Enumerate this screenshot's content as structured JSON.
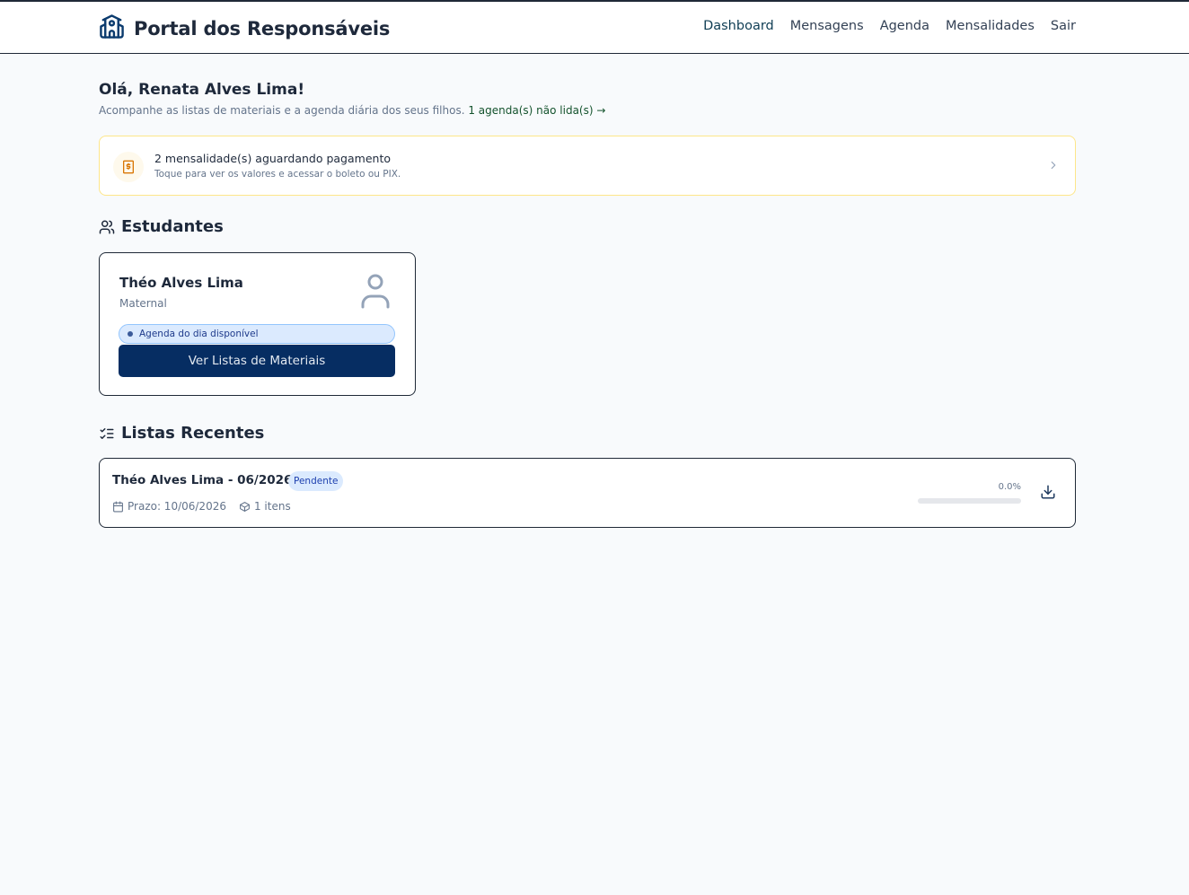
{
  "header": {
    "title": "Portal dos Responsáveis",
    "logo_icon": "school-icon",
    "nav": [
      {
        "label": "Dashboard",
        "active": true
      },
      {
        "label": "Mensagens"
      },
      {
        "label": "Agenda"
      },
      {
        "label": "Mensalidades"
      },
      {
        "label": "Sair"
      }
    ]
  },
  "greeting": {
    "title": "Olá, Renata Alves Lima!",
    "subtitle": "Acompanhe as listas de materiais e a agenda diária dos seus filhos.",
    "agenda_link": "1 agenda(s) não lida(s) →"
  },
  "payment_alert": {
    "icon": "receipt-dollar-icon",
    "title": "2 mensalidade(s) aguardando pagamento",
    "subtitle": "Toque para ver os valores e acessar o boleto ou PIX."
  },
  "students_section": {
    "title": "Estudantes",
    "students": [
      {
        "name": "Théo Alves Lima",
        "class": "Maternal",
        "agenda_badge": "Agenda do dia disponível",
        "button_label": "Ver Listas de Materiais"
      }
    ]
  },
  "lists_section": {
    "title": "Listas Recentes",
    "lists": [
      {
        "title": "Théo Alves Lima - 06/2026",
        "status": "Pendente",
        "deadline": "Prazo: 10/06/2026",
        "items": "1 itens",
        "progress_label": "0.0%",
        "progress": 0
      }
    ]
  },
  "colors": {
    "primary": "#062d62",
    "alert_border": "#fde68a",
    "badge_bg": "#dbeafe",
    "link": "#14532d"
  }
}
